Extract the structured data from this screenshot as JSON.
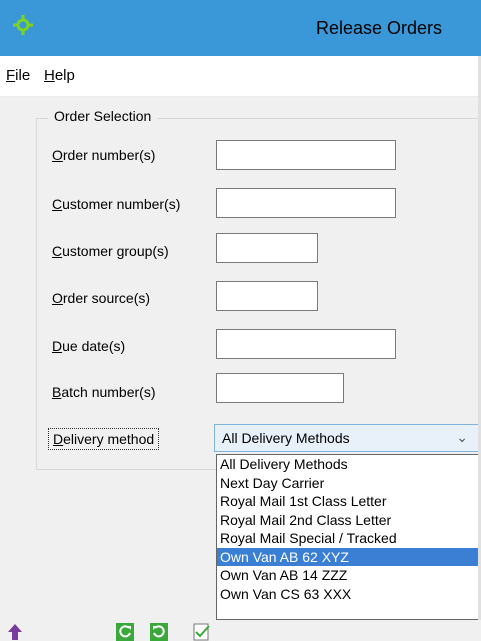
{
  "window": {
    "title": "Release Orders"
  },
  "menu": {
    "file_u": "F",
    "file_rest": "ile",
    "help_u": "H",
    "help_rest": "elp"
  },
  "group": {
    "title": "Order Selection"
  },
  "fields": [
    {
      "u": "O",
      "rest": "rder number(s)",
      "value": ""
    },
    {
      "u": "C",
      "rest": "ustomer number(s)",
      "value": ""
    },
    {
      "u": "C",
      "rest": "ustomer group(s)",
      "value": ""
    },
    {
      "u": "O",
      "rest": "rder source(s)",
      "value": ""
    },
    {
      "u": "D",
      "rest": "ue date(s)",
      "value": ""
    },
    {
      "u": "B",
      "rest": "atch number(s)",
      "value": ""
    }
  ],
  "delivery": {
    "label_u": "D",
    "label_rest": "elivery method",
    "selected": "All Delivery Methods",
    "options": [
      "All Delivery Methods",
      "Next Day Carrier",
      "Royal Mail 1st Class Letter",
      "Royal Mail 2nd Class Letter",
      "Royal Mail Special / Tracked",
      "Own Van AB 62 XYZ",
      "Own Van AB 14 ZZZ",
      "Own Van CS 63 XXX"
    ],
    "highlighted_index": 5
  },
  "colors": {
    "titlebar": "#3a98d8",
    "highlight": "#3a7fd4",
    "icon_green": "#3aa83a"
  },
  "icons": [
    "gear-icon",
    "up-arrow-icon",
    "refresh-icon",
    "reset-icon",
    "checklist-icon"
  ]
}
